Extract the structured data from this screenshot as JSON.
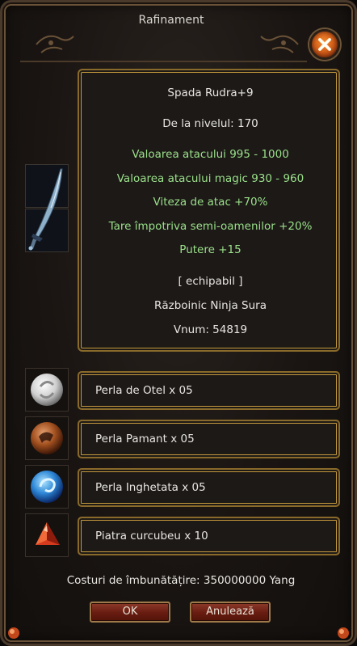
{
  "window": {
    "title": "Rafinament"
  },
  "item": {
    "name": "Spada Rudra+9",
    "level": "De la nivelul: 170",
    "attack": "Valoarea atacului 995 - 1000",
    "magic_attack": "Valoarea atacului magic 930 - 960",
    "attack_speed": "Viteza de atac +70%",
    "bonus_half_humans": "Tare împotriva semi-oamenilor  +20%",
    "strength": "Putere  +15",
    "equippable": "[ echipabil ]",
    "class": "Războinic Ninja Sura",
    "vnum": "Vnum: 54819",
    "icon": "sword-icon"
  },
  "materials": [
    {
      "label": "Perla de Otel x 05",
      "icon": "white-pearl-icon"
    },
    {
      "label": "Perla Pamant x 05",
      "icon": "brown-pearl-icon"
    },
    {
      "label": "Perla Inghetata x 05",
      "icon": "blue-pearl-icon"
    },
    {
      "label": "Piatra curcubeu x 10",
      "icon": "rainbow-stone-icon"
    }
  ],
  "cost": "Costuri de îmbunătățire: 350000000 Yang",
  "buttons": {
    "ok": "OK",
    "cancel": "Anulează"
  },
  "colors": {
    "green_text": "#9be08a",
    "white_text": "#e8e6e1",
    "gold_border": "#c59a3c",
    "close_orange": "#e0701e"
  }
}
